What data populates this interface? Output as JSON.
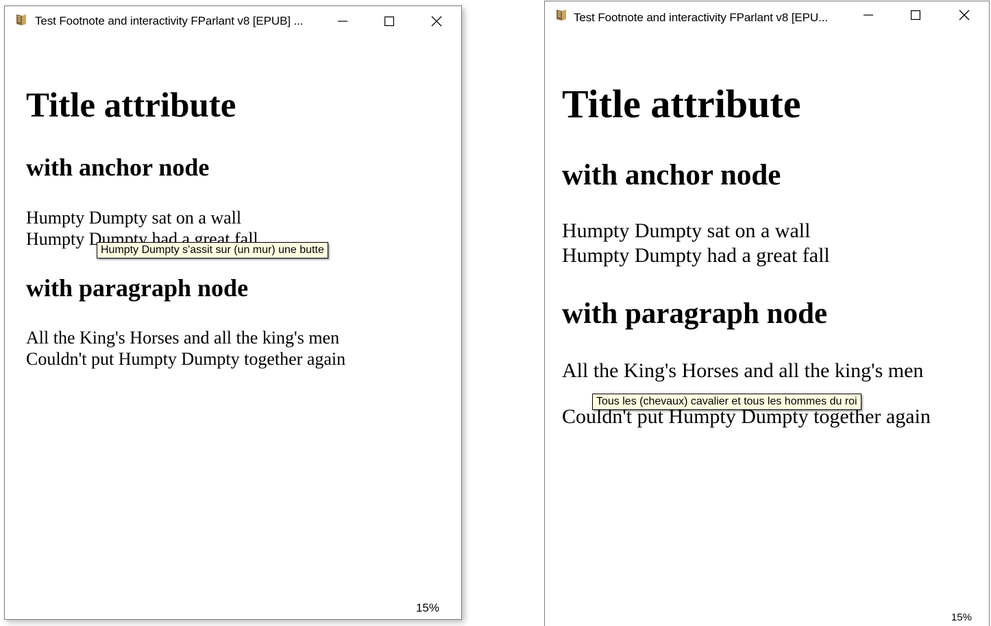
{
  "windows": [
    {
      "title": "Test Footnote and interactivity FParlant v8 [EPUB] ...",
      "heading": "Title attribute",
      "section1_heading": "with anchor node",
      "section1_lines": [
        "Humpty Dumpty sat on a wall",
        "Humpty Dumpty had a great fall"
      ],
      "section2_heading": "with paragraph node",
      "section2_lines": [
        "All the King's Horses and all the king's men",
        "Couldn't put Humpty Dumpty together again"
      ],
      "tooltip": "Humpty Dumpty s'assit sur (un mur) une butte",
      "progress": "15%"
    },
    {
      "title": "Test Footnote and interactivity FParlant v8 [EPU...",
      "heading": "Title attribute",
      "section1_heading": "with anchor node",
      "section1_lines": [
        "Humpty Dumpty sat on a wall",
        "Humpty Dumpty had a great fall"
      ],
      "section2_heading": "with paragraph node",
      "section2_lines": [
        "All the King's Horses and all the king's men",
        "Couldn't put Humpty Dumpty together again"
      ],
      "tooltip": "Tous les (chevaux) cavalier et tous les hommes du roi",
      "progress": "15%"
    }
  ],
  "controls": {
    "minimize_icon": "minimize-icon",
    "maximize_icon": "maximize-icon",
    "close_icon": "close-icon",
    "app_icon": "app-book-icon"
  },
  "colors": {
    "tooltip_background": "#ffffe1",
    "window_border": "#7a7a7a"
  }
}
